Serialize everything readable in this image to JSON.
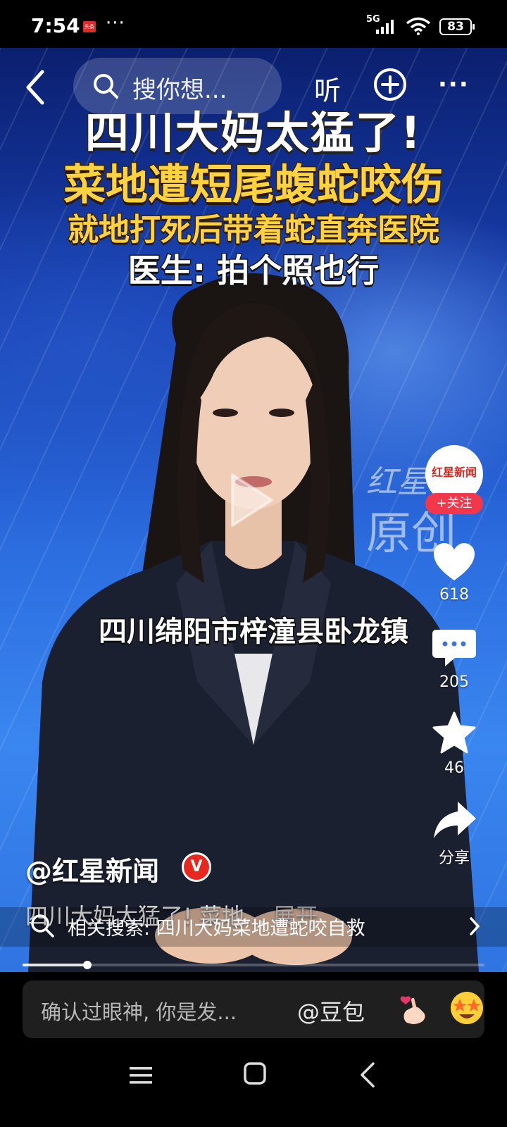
{
  "status_bar": {
    "time": "7:54",
    "app_badge": "头条",
    "dots": "···",
    "network": "5G",
    "battery": "83"
  },
  "top_bar": {
    "search_placeholder": "搜你想...",
    "listen_label": "听"
  },
  "video": {
    "headline_1": "四川大妈太猛了!",
    "headline_2": "菜地遭短尾蝮蛇咬伤",
    "headline_3": "就地打死后带着蛇直奔医院",
    "headline_4": "医生: 拍个照也行",
    "caption": "四川绵阳市梓潼县卧龙镇",
    "watermark_line1": "红星新",
    "watermark_line2": "原创"
  },
  "author": {
    "handle": "@红星新闻",
    "verified_mark": "V",
    "avatar_text": "红星新闻",
    "follow_label": "+关注"
  },
  "actions": {
    "likes": "618",
    "comments": "205",
    "favorites": "46",
    "share_label": "分享"
  },
  "description": {
    "text": "四川大妈太猛了! 菜地...",
    "expand_label": "展开"
  },
  "related_search": {
    "text": "相关搜索: 四川大妈菜地遭蛇咬自救"
  },
  "playback": {
    "progress": 0.14
  },
  "comment_bar": {
    "placeholder": "确认过眼神, 你是发...",
    "mention": "@豆包"
  },
  "colors": {
    "accent_red": "#f2374a",
    "headline_yellow": "#ffd23f"
  }
}
